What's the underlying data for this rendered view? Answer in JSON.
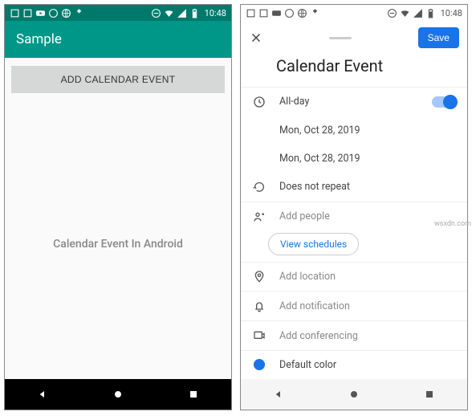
{
  "statusbar": {
    "time": "10:48"
  },
  "phone1": {
    "app_title": "Sample",
    "add_button": "ADD CALENDAR EVENT",
    "center_text": "Calendar Event In Android"
  },
  "phone2": {
    "save": "Save",
    "title": "Calendar Event",
    "allday": "All-day",
    "start_date": "Mon, Oct 28, 2019",
    "end_date": "Mon, Oct 28, 2019",
    "repeat": "Does not repeat",
    "add_people": "Add people",
    "view_schedules": "View schedules",
    "add_location": "Add location",
    "add_notification": "Add notification",
    "add_conferencing": "Add conferencing",
    "default_color": "Default color"
  },
  "watermark": "wsxdn.com"
}
